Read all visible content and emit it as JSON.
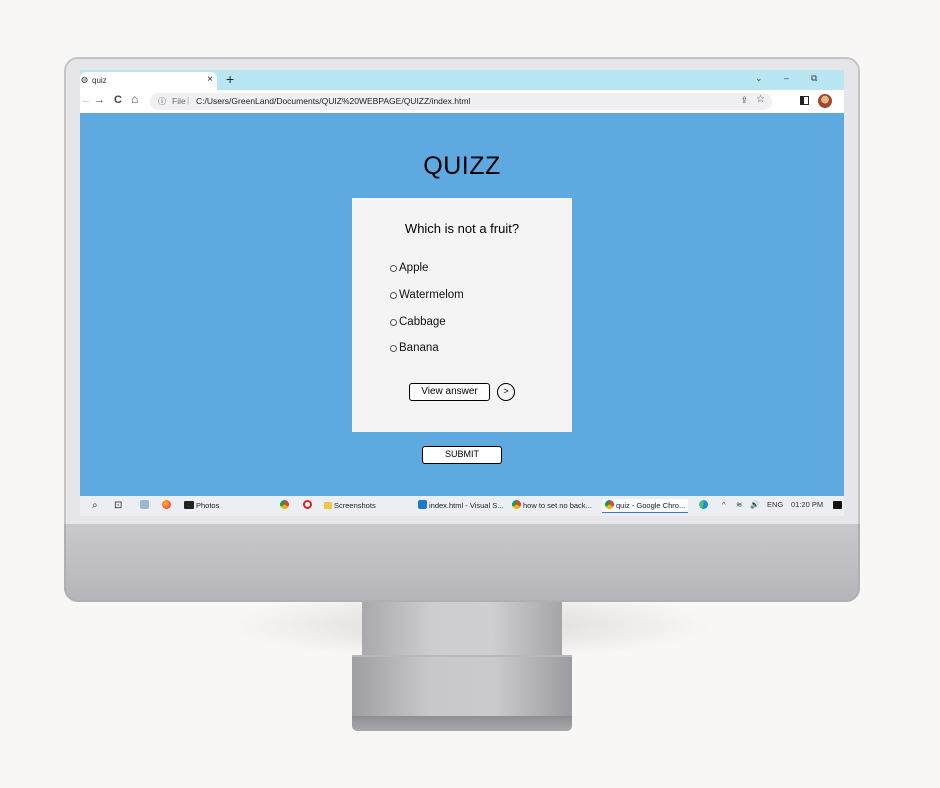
{
  "browser": {
    "tab_title": "quiz",
    "tab_close": "×",
    "new_tab": "+",
    "win_chevron": "⌄",
    "win_minimize": "–",
    "win_restore": "⧉",
    "back": "←",
    "forward": "→",
    "reload": "C",
    "home": "⌂",
    "info_icon": "ⓘ",
    "file_label": "File",
    "separator": "|",
    "url": "C:/Users/GreenLand/Documents/QUIZ%20WEBPAGE/QUIZZ/index.html",
    "share_icon": "⇪",
    "star_icon": "☆"
  },
  "page": {
    "title": "QUIZZ",
    "question": "Which is not a fruit?",
    "options": [
      "Apple",
      "Watermelom",
      "Cabbage",
      "Banana"
    ],
    "view_answer_label": "View answer",
    "next_label": ">",
    "submit_label": "SUBMIT"
  },
  "taskbar": {
    "search_icon": "⌕",
    "task_view_icon": "⊡",
    "photos_label": "Photos",
    "screenshots_label": "Screenshots",
    "vscode_label": "index.html - Visual S...",
    "chrome_tab1_label": "how to set no back...",
    "chrome_tab2_label": "quiz - Google Chro...",
    "tray_chevron": "^",
    "wifi_icon": "≋",
    "volume_icon": "🔊",
    "language": "ENG",
    "time": "01:20 PM"
  },
  "colors": {
    "page_background": "#5da9e0",
    "card_background": "#f4f4f4",
    "tab_strip": "#b9e6f3"
  }
}
